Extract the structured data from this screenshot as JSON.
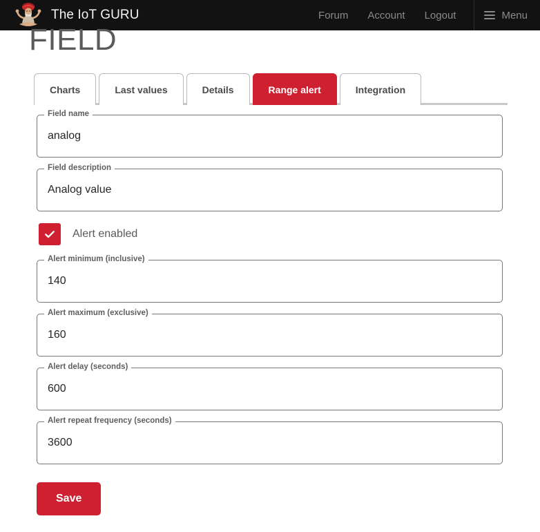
{
  "header": {
    "brand_title": "The IoT GURU",
    "logo_icon": "guru-meditating-logo",
    "links": [
      {
        "label": "Forum"
      },
      {
        "label": "Account"
      },
      {
        "label": "Logout"
      }
    ],
    "menu_label": "Menu",
    "menu_icon": "hamburger-icon",
    "background_color": "#121212",
    "link_color": "#8a8a8a"
  },
  "page": {
    "title": "FIELD"
  },
  "tabs": [
    {
      "label": "Charts",
      "active": false
    },
    {
      "label": "Last values",
      "active": false
    },
    {
      "label": "Details",
      "active": false
    },
    {
      "label": "Range alert",
      "active": true
    },
    {
      "label": "Integration",
      "active": false
    }
  ],
  "form": {
    "fields": [
      {
        "label": "Field name",
        "value": "analog"
      },
      {
        "label": "Field description",
        "value": "Analog value"
      },
      {
        "label": "Alert minimum (inclusive)",
        "value": "140"
      },
      {
        "label": "Alert maximum (exclusive)",
        "value": "160"
      },
      {
        "label": "Alert delay (seconds)",
        "value": "600"
      },
      {
        "label": "Alert repeat frequency (seconds)",
        "value": "3600"
      }
    ],
    "checkbox": {
      "label": "Alert enabled",
      "checked": true,
      "icon": "check-icon"
    },
    "save_label": "Save"
  },
  "colors": {
    "accent_red": "#ce2030",
    "header_dark": "#121212",
    "field_border": "#757575",
    "title_gray": "#5a5a5a"
  }
}
